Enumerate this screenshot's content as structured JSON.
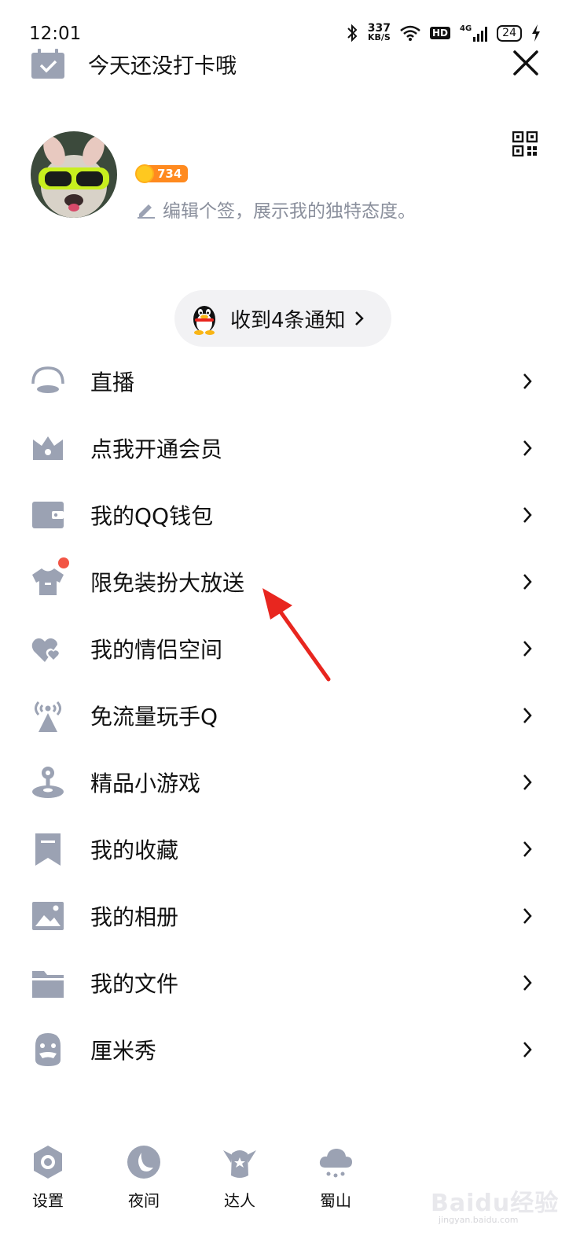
{
  "status_bar": {
    "time": "12:01",
    "net_speed_value": "337",
    "net_speed_unit": "KB/S",
    "hd_label": "HD",
    "network_label": "4G",
    "battery": "24"
  },
  "top_bar": {
    "checkin_text": "今天还没打卡哦",
    "close_icon": "close-icon"
  },
  "profile": {
    "level_points": "734",
    "signature_placeholder": "编辑个签，展示我的独特态度。"
  },
  "notification": {
    "label": "收到4条通知"
  },
  "menu": {
    "items": [
      {
        "label": "直播",
        "icon": "live-icon"
      },
      {
        "label": "点我开通会员",
        "icon": "crown-icon"
      },
      {
        "label": "我的QQ钱包",
        "icon": "wallet-icon"
      },
      {
        "label": "限免装扮大放送",
        "icon": "tshirt-icon",
        "badge": "red-dot"
      },
      {
        "label": "我的情侣空间",
        "icon": "hearts-icon"
      },
      {
        "label": "免流量玩手Q",
        "icon": "signal-tower-icon"
      },
      {
        "label": "精品小游戏",
        "icon": "joystick-icon"
      },
      {
        "label": "我的收藏",
        "icon": "bookmark-icon"
      },
      {
        "label": "我的相册",
        "icon": "photo-icon"
      },
      {
        "label": "我的文件",
        "icon": "folder-icon"
      },
      {
        "label": "厘米秀",
        "icon": "cmshow-face-icon"
      }
    ]
  },
  "bottom_bar": {
    "items": [
      {
        "label": "设置",
        "icon": "settings-icon"
      },
      {
        "label": "夜间",
        "icon": "moon-icon"
      },
      {
        "label": "达人",
        "icon": "expert-badge-icon"
      },
      {
        "label": "蜀山",
        "icon": "cloud-icon"
      }
    ]
  },
  "watermark": {
    "text": "Baidu经验",
    "sub": "jingyan.baidu.com"
  },
  "colors": {
    "icon_gray": "#9ba2b3",
    "accent_red": "#f25545",
    "annotation_arrow": "#e8261f",
    "level_badge": "#ff8a1f",
    "pill_bg": "#f2f2f4"
  }
}
